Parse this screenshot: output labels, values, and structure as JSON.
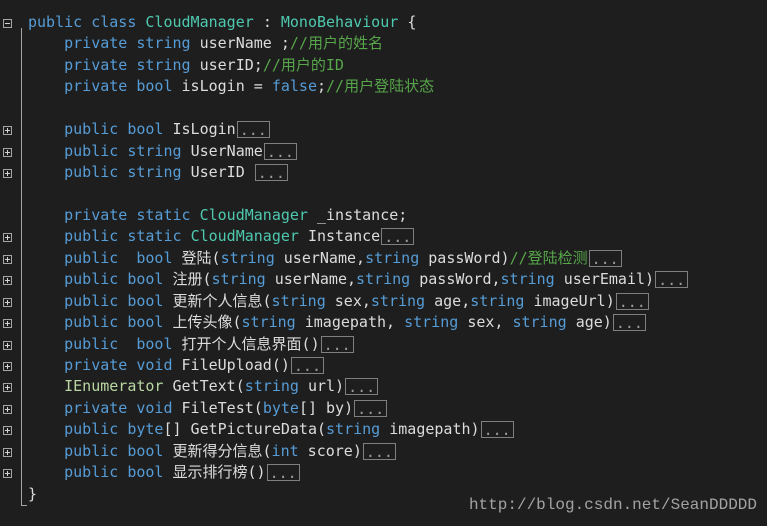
{
  "code": {
    "class_line": {
      "kw": "public class",
      "type": "CloudManager",
      "sep": ":",
      "base": "MonoBehaviour",
      "brace": "{"
    },
    "fields": [
      {
        "mod": "private string",
        "name": "userName ;",
        "comment": "//用户的姓名"
      },
      {
        "mod": "private string",
        "name": "userID;",
        "comment": "//用户的ID"
      },
      {
        "mod": "private bool",
        "name": "isLogin = ",
        "value": "false",
        "semi": ";",
        "comment": "//用户登陆状态"
      }
    ],
    "properties": [
      {
        "mod": "public bool",
        "name": "IsLogin",
        "ellipsis": "..."
      },
      {
        "mod": "public string",
        "name": "UserName",
        "ellipsis": "..."
      },
      {
        "mod": "public string",
        "name": "UserID ",
        "ellipsis": "..."
      }
    ],
    "instance_field": {
      "mod": "private static",
      "type": "CloudManager",
      "name": "_instance;"
    },
    "instance_prop": {
      "mod": "public static",
      "type": "CloudManager",
      "name": "Instance",
      "ellipsis": "..."
    },
    "methods": [
      {
        "mod": "public  bool",
        "name": "登陆(",
        "params": [
          {
            "kw": "string",
            "id": "userName,"
          },
          {
            "kw": "string",
            "id": "passWord)"
          }
        ],
        "comment": "//登陆检测",
        "ellipsis": "..."
      },
      {
        "mod": "public bool",
        "name": "注册(",
        "params": [
          {
            "kw": "string",
            "id": "userName,"
          },
          {
            "kw": "string",
            "id": "passWord,"
          },
          {
            "kw": "string",
            "id": "userEmail)"
          }
        ],
        "comment": "",
        "ellipsis": "..."
      },
      {
        "mod": "public bool",
        "name": "更新个人信息(",
        "params": [
          {
            "kw": "string",
            "id": "sex,"
          },
          {
            "kw": "string",
            "id": "age,"
          },
          {
            "kw": "string",
            "id": "imageUrl)"
          }
        ],
        "comment": "",
        "ellipsis": "..."
      },
      {
        "mod": "public bool",
        "name": "上传头像(",
        "params": [
          {
            "kw": "string",
            "id": "imagepath, "
          },
          {
            "kw": "string",
            "id": "sex, "
          },
          {
            "kw": "string",
            "id": "age)"
          }
        ],
        "comment": "",
        "ellipsis": "..."
      },
      {
        "mod": "public  bool",
        "name": "打开个人信息界面()",
        "params": [],
        "comment": "",
        "ellipsis": "..."
      },
      {
        "mod": "private void",
        "name": "FileUpload()",
        "params": [],
        "comment": "",
        "ellipsis": "..."
      },
      {
        "mod": "",
        "type": "IEnumerator",
        "name": "GetText(",
        "params": [
          {
            "kw": "string",
            "id": "url)"
          }
        ],
        "comment": "",
        "ellipsis": "..."
      },
      {
        "mod": "private void",
        "name": "FileTest(",
        "params": [
          {
            "kw": "byte",
            "id": "[] by)"
          }
        ],
        "comment": "",
        "ellipsis": "..."
      },
      {
        "mod": "public byte",
        "name": "[] GetPictureData(",
        "params": [
          {
            "kw": "string",
            "id": "imagepath)"
          }
        ],
        "comment": "",
        "ellipsis": "..."
      },
      {
        "mod": "public bool",
        "name": "更新得分信息(",
        "params": [
          {
            "kw": "int",
            "id": "score)"
          }
        ],
        "comment": "",
        "ellipsis": "..."
      },
      {
        "mod": "public bool",
        "name": "显示排行榜()",
        "params": [],
        "comment": "",
        "ellipsis": "..."
      }
    ],
    "closing_brace": "}"
  },
  "watermark": "http://blog.csdn.net/SeanDDDDD",
  "colors": {
    "keyword": "#569cd6",
    "type": "#4ec9b0",
    "comment": "#57a64a",
    "text": "#dcdcdc",
    "background": "#1e1e1e"
  }
}
